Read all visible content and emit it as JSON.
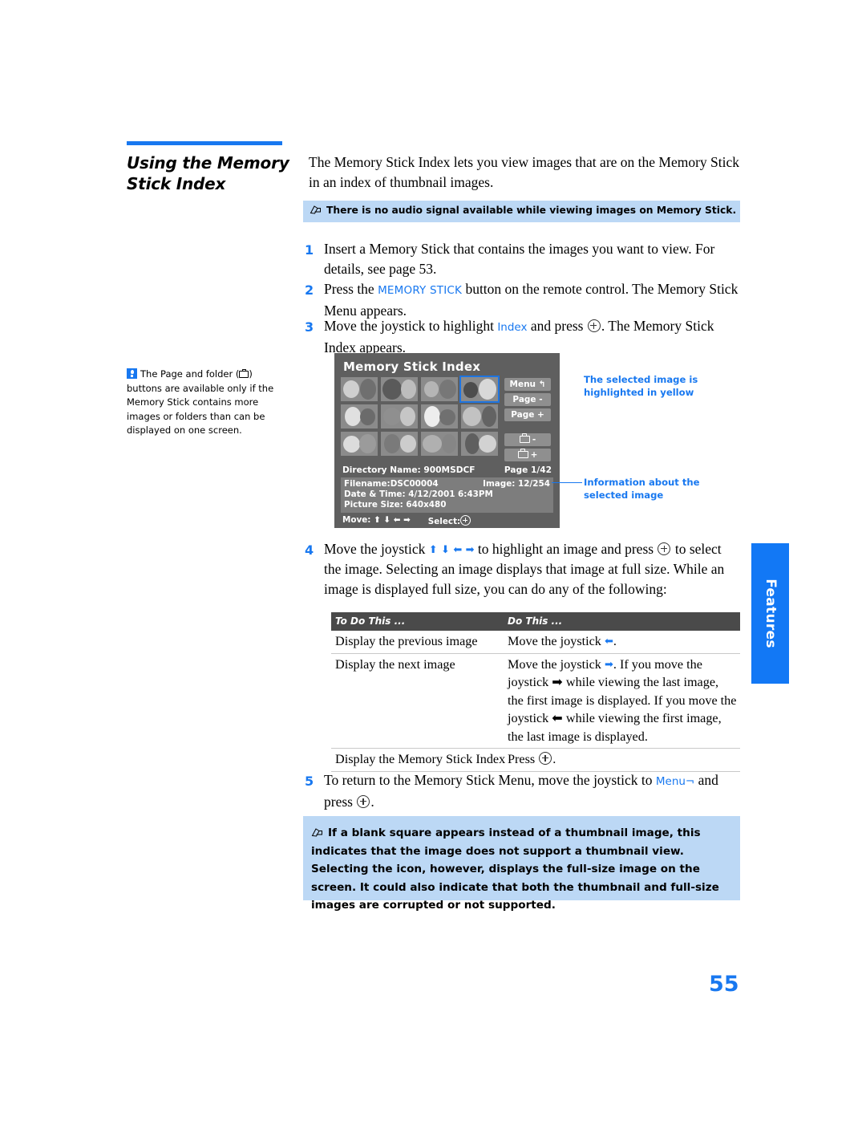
{
  "section": {
    "title": "Using the Memory\nStick Index",
    "accent_color": "#1878f0"
  },
  "intro": "The Memory Stick Index lets you view images that are on the Memory Stick in an index of thumbnail images.",
  "notes": {
    "top": "There is no audio signal available while viewing images on Memory Stick.",
    "bottom": "If a blank square appears instead of a thumbnail image, this indicates that the image does not support a thumbnail view. Selecting the icon, however, displays the full-size image on the screen. It could also indicate that both the thumbnail and full-size images are corrupted or not supported.",
    "icon": "note-pen-icon",
    "background": "#bcd8f5"
  },
  "tip": {
    "icon": "lightbulb-icon",
    "text_before": "The Page and folder (",
    "text_after": ") buttons are available only if the Memory Stick contains more images or folders than can be displayed on one screen."
  },
  "steps": [
    {
      "num": "1",
      "parts": [
        {
          "type": "text",
          "value": "Insert a Memory Stick that contains the images you want to view. For details, see page 53."
        }
      ]
    },
    {
      "num": "2",
      "parts": [
        {
          "type": "text",
          "value": "Press the "
        },
        {
          "type": "blue",
          "value": "MEMORY STICK"
        },
        {
          "type": "text",
          "value": " button on the remote control. The Memory Stick Menu appears."
        }
      ]
    },
    {
      "num": "3",
      "parts": [
        {
          "type": "text",
          "value": "Move the joystick to highlight "
        },
        {
          "type": "blue",
          "value": "Index"
        },
        {
          "type": "text",
          "value": " and press "
        },
        {
          "type": "icon",
          "value": "select-plus-icon"
        },
        {
          "type": "text",
          "value": ". The Memory Stick Index appears."
        }
      ]
    },
    {
      "num": "4",
      "parts": [
        {
          "type": "text",
          "value": "Move the joystick "
        },
        {
          "type": "arrows",
          "value": "up down left right"
        },
        {
          "type": "text",
          "value": " to highlight an image and press "
        },
        {
          "type": "icon",
          "value": "select-plus-icon"
        },
        {
          "type": "text",
          "value": " to select the image. Selecting an image displays that image at full size. While an image is displayed full size, you can do any of the following:"
        }
      ]
    },
    {
      "num": "5",
      "parts": [
        {
          "type": "text",
          "value": "To return to the Memory Stick Menu, move the joystick to "
        },
        {
          "type": "blue",
          "value": "Menu¬"
        },
        {
          "type": "text",
          "value": " and press "
        },
        {
          "type": "icon",
          "value": "select-plus-icon"
        },
        {
          "type": "text",
          "value": "."
        }
      ]
    }
  ],
  "step_text": {
    "s1": "Insert a Memory Stick that contains the images you want to view. For details, see page 53.",
    "s2_a": "Press the ",
    "s2_link": "MEMORY STICK",
    "s2_b": " button on the remote control. The Memory Stick Menu appears.",
    "s3_a": "Move the joystick to highlight ",
    "s3_link": "Index",
    "s3_b": " and press ",
    "s3_c": ". The Memory Stick Index appears.",
    "s4_a": "Move the joystick ",
    "s4_b": " to highlight an image and press ",
    "s4_c": " to select the image. Selecting an image displays that image at full size. While an image is displayed full size, you can do any of the following:",
    "s5_a": "To return to the Memory Stick Menu, move the joystick to ",
    "s5_link": "Menu¬",
    "s5_b": " and press ",
    "s5_c": "."
  },
  "screen": {
    "title": "Memory Stick Index",
    "buttons": [
      {
        "label": "Menu ↰",
        "name": "menu-button"
      },
      {
        "label": "Page -",
        "name": "page-minus-button"
      },
      {
        "label": "Page +",
        "name": "page-plus-button"
      }
    ],
    "folder_buttons": [
      {
        "label": "-",
        "name": "folder-minus-button"
      },
      {
        "label": "+",
        "name": "folder-plus-button"
      }
    ],
    "directory_label": "Directory Name: 900MSDCF",
    "page_label": "Page 1/42",
    "filename": "Filename:DSC00004",
    "image_count": "Image: 12/254",
    "datetime": "Date & Time: 4/12/2001 6:43PM",
    "picture_size": "Picture Size: 640x480",
    "move_label": "Move:",
    "move_arrows": "⬆ ⬇ ⬅ ➡",
    "select_label": "Select:",
    "selected_index": 3,
    "thumb_count": 12,
    "selection_color": "#1e74e0"
  },
  "callouts": {
    "selected": "The selected image is highlighted in yellow",
    "info": "Information about the selected image"
  },
  "table": {
    "headers": [
      "To Do This ...",
      "Do This ..."
    ],
    "rows": [
      {
        "action": "Display the previous image",
        "result_pre": "Move the joystick ",
        "result_post": "."
      },
      {
        "action": "Display the next image",
        "result_pre": "Move the joystick ",
        "result_post": ". If you move the joystick ➡ while viewing the last image, the first image is displayed. If you move the joystick ⬅ while viewing the first image, the last image is displayed."
      },
      {
        "action": "Display the Memory Stick Index",
        "result_pre": "Press ",
        "result_post": "."
      }
    ]
  },
  "side_tab": {
    "label": "Features",
    "color": "#1278f5"
  },
  "folio": "55"
}
